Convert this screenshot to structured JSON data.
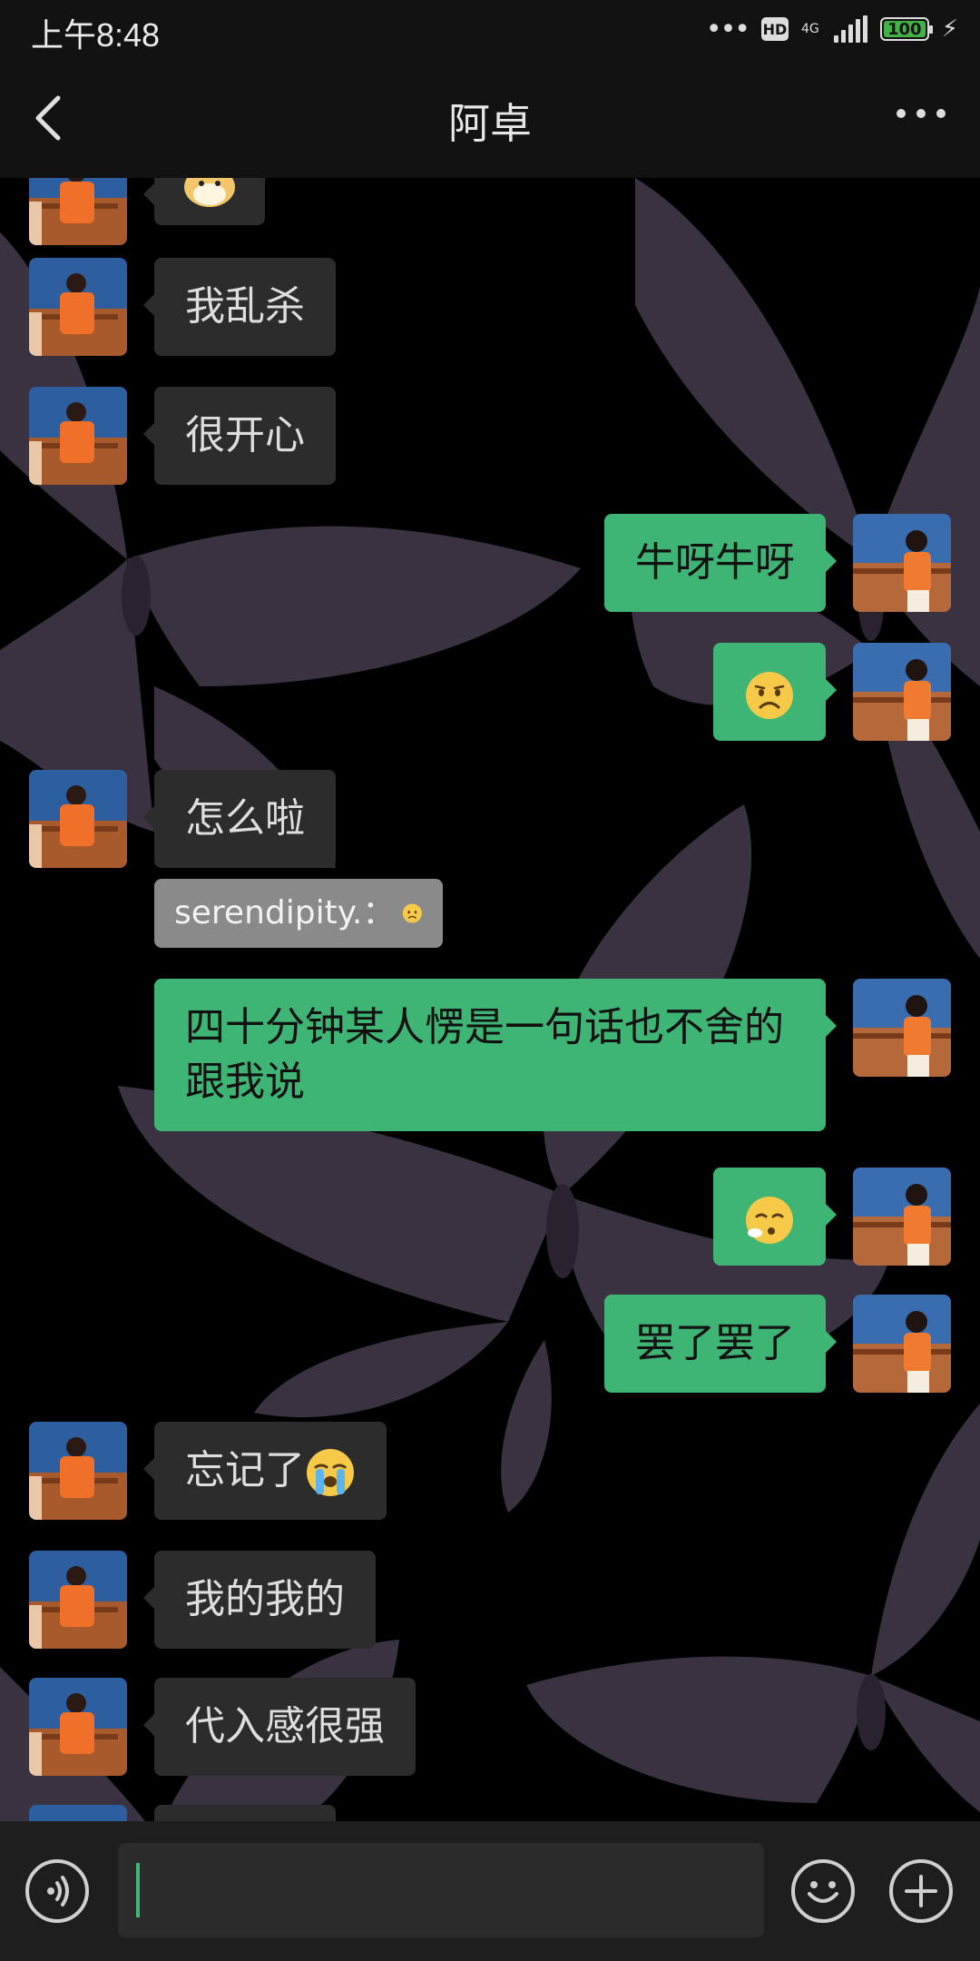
{
  "status_bar": {
    "time": "上午8:48",
    "hd": "HD",
    "network": "4G",
    "battery": "100"
  },
  "header": {
    "title": "阿卓"
  },
  "messages": [
    {
      "side": "in",
      "text": ""
    },
    {
      "side": "in",
      "text": "我乱杀"
    },
    {
      "side": "in",
      "text": "很开心"
    },
    {
      "side": "out",
      "text": "牛呀牛呀"
    },
    {
      "side": "out",
      "emoji": "frowning-face"
    },
    {
      "side": "in",
      "text": "怎么啦"
    },
    {
      "side": "in",
      "quote_text": "serendipity.：",
      "quote_emoji": "frowning-face"
    },
    {
      "side": "out",
      "text": "四十分钟某人愣是一句话也不舍的跟我说"
    },
    {
      "side": "out",
      "emoji": "exhaling-face"
    },
    {
      "side": "out",
      "text": "罢了罢了"
    },
    {
      "side": "in",
      "text": "忘记了",
      "emoji": "loudly-crying-face"
    },
    {
      "side": "in",
      "text": "我的我的"
    },
    {
      "side": "in",
      "text": "代入感很强"
    }
  ],
  "input": {
    "placeholder": ""
  },
  "colors": {
    "out_bubble": "#3eb575",
    "in_bubble": "#2c2c2c",
    "bar": "#121212"
  }
}
